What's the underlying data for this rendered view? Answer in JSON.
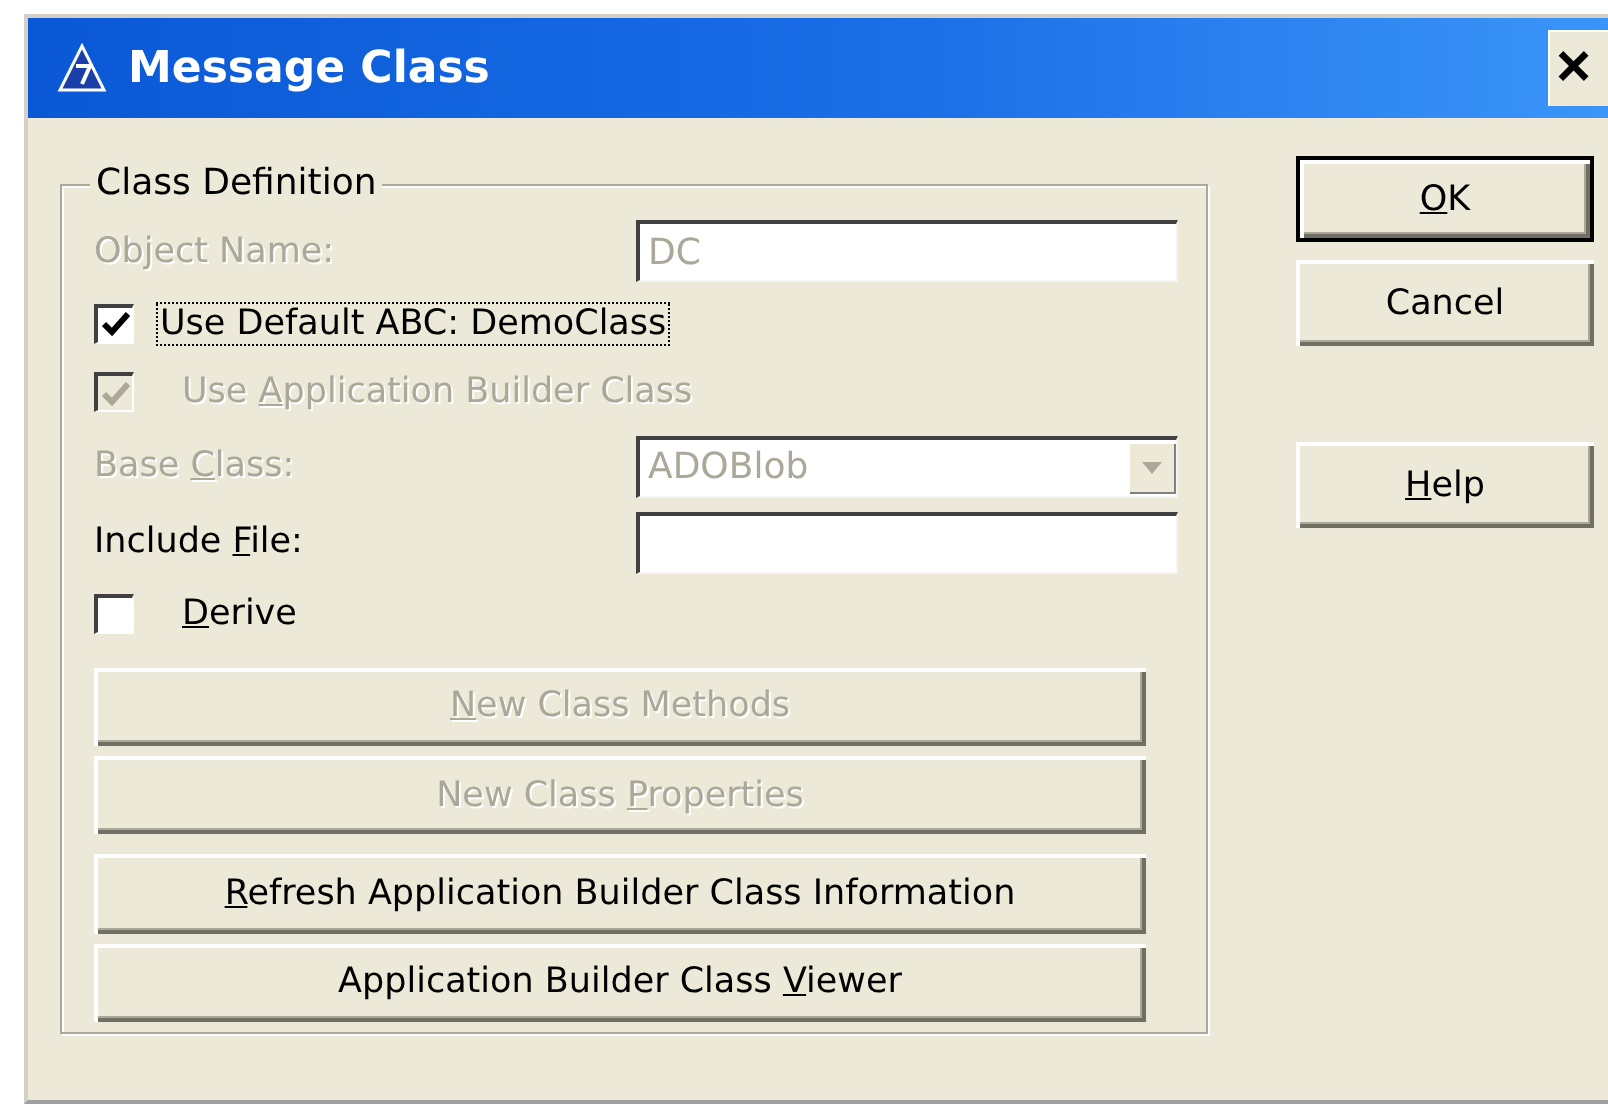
{
  "window": {
    "title": "Message Class",
    "close_symbol": "×"
  },
  "group": {
    "title": "Class Definition",
    "rows": [
      {
        "kind": "field",
        "label": [
          {
            "text": "Object Name:",
            "underline": false
          }
        ],
        "value": "DC",
        "disabled": true
      },
      {
        "kind": "checkbox",
        "label": [
          {
            "text": "Use Default ABC: DemoClass",
            "underline": false
          }
        ],
        "checked": true,
        "disabled": false,
        "focused": true
      },
      {
        "kind": "checkbox",
        "label": [
          {
            "text": "Use ",
            "underline": false
          },
          {
            "text": "A",
            "underline": true
          },
          {
            "text": "pplication Builder Class",
            "underline": false
          }
        ],
        "checked": true,
        "disabled": true,
        "focused": false
      },
      {
        "kind": "combo",
        "label": [
          {
            "text": "Base ",
            "underline": false
          },
          {
            "text": "C",
            "underline": true
          },
          {
            "text": "lass:",
            "underline": false
          }
        ],
        "value": "ADOBlob",
        "disabled": true
      },
      {
        "kind": "field",
        "label": [
          {
            "text": "Include ",
            "underline": false
          },
          {
            "text": "F",
            "underline": true
          },
          {
            "text": "ile:",
            "underline": false
          }
        ],
        "disabled": false
      },
      {
        "kind": "checkbox",
        "label": [
          {
            "text": "D",
            "underline": true
          },
          {
            "text": "erive",
            "underline": false
          }
        ],
        "checked": false,
        "disabled": false,
        "focused": false
      },
      {
        "kind": "button",
        "label": [
          {
            "text": "N",
            "underline": true
          },
          {
            "text": "ew Class Methods",
            "underline": false
          }
        ],
        "disabled": true,
        "gap": false
      },
      {
        "kind": "button",
        "label": [
          {
            "text": "New Class ",
            "underline": false
          },
          {
            "text": "P",
            "underline": true
          },
          {
            "text": "roperties",
            "underline": false
          }
        ],
        "disabled": true,
        "gap": false
      },
      {
        "kind": "button",
        "label": [
          {
            "text": "R",
            "underline": true
          },
          {
            "text": "efresh Application Builder Class Information",
            "underline": false
          }
        ],
        "disabled": false,
        "gap": true
      },
      {
        "kind": "button",
        "label": [
          {
            "text": "Application Builder Class ",
            "underline": false
          },
          {
            "text": "V",
            "underline": true
          },
          {
            "text": "iewer",
            "underline": false
          }
        ],
        "disabled": false,
        "gap": false
      }
    ]
  },
  "buttons": [
    {
      "label": [
        {
          "text": "O",
          "underline": true
        },
        {
          "text": "K",
          "underline": false
        }
      ],
      "default": true
    },
    {
      "label": [
        {
          "text": "Cancel",
          "underline": false
        }
      ],
      "default": false
    },
    {
      "label": [
        {
          "text": "H",
          "underline": true
        },
        {
          "text": "elp",
          "underline": false
        }
      ],
      "default": false
    }
  ]
}
